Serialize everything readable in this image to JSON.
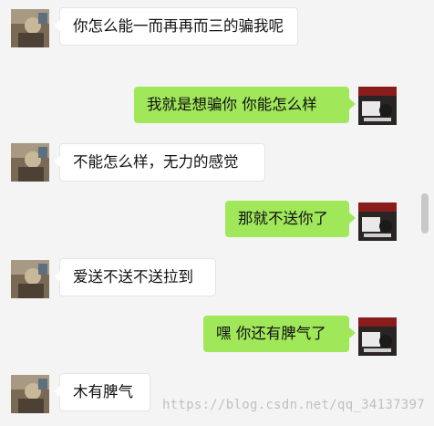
{
  "colors": {
    "background": "#f4f4f4",
    "incoming_bubble": "#ffffff",
    "outgoing_bubble": "#a0e75a",
    "text": "#111111"
  },
  "messages": [
    {
      "sender": "other",
      "text": "你怎么能一而再再而三的骗我呢"
    },
    {
      "sender": "me",
      "text": "我就是想骗你  你能怎么样"
    },
    {
      "sender": "other",
      "text": "不能怎么样，无力的感觉"
    },
    {
      "sender": "me",
      "text": "那就不送你了"
    },
    {
      "sender": "other",
      "text": "爱送不送不送拉到"
    },
    {
      "sender": "me",
      "text": "嘿 你还有脾气了"
    },
    {
      "sender": "other",
      "text": "木有脾气"
    }
  ],
  "watermark": "https://blog.csdn.net/qq_34137397"
}
